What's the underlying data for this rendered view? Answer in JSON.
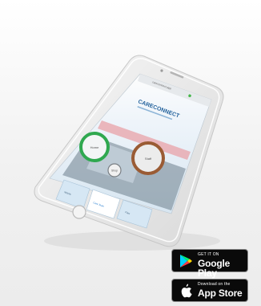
{
  "phone": {
    "browser_url": "careconnect.app",
    "app_logo_text": "CARECONNECT",
    "circle_labels": [
      "Home",
      "Staff",
      "Shop"
    ],
    "tiles": [
      "Mobile",
      "Care Team",
      "Files"
    ]
  },
  "badges": {
    "google_play": {
      "small": "GET IT ON",
      "big": "Google Play"
    },
    "app_store": {
      "small": "Download on the",
      "big": "App Store"
    }
  },
  "colors": {
    "circle_green": "#2fa84f",
    "circle_brown": "#9a5b34",
    "accent_blue": "#2a7fd0"
  }
}
